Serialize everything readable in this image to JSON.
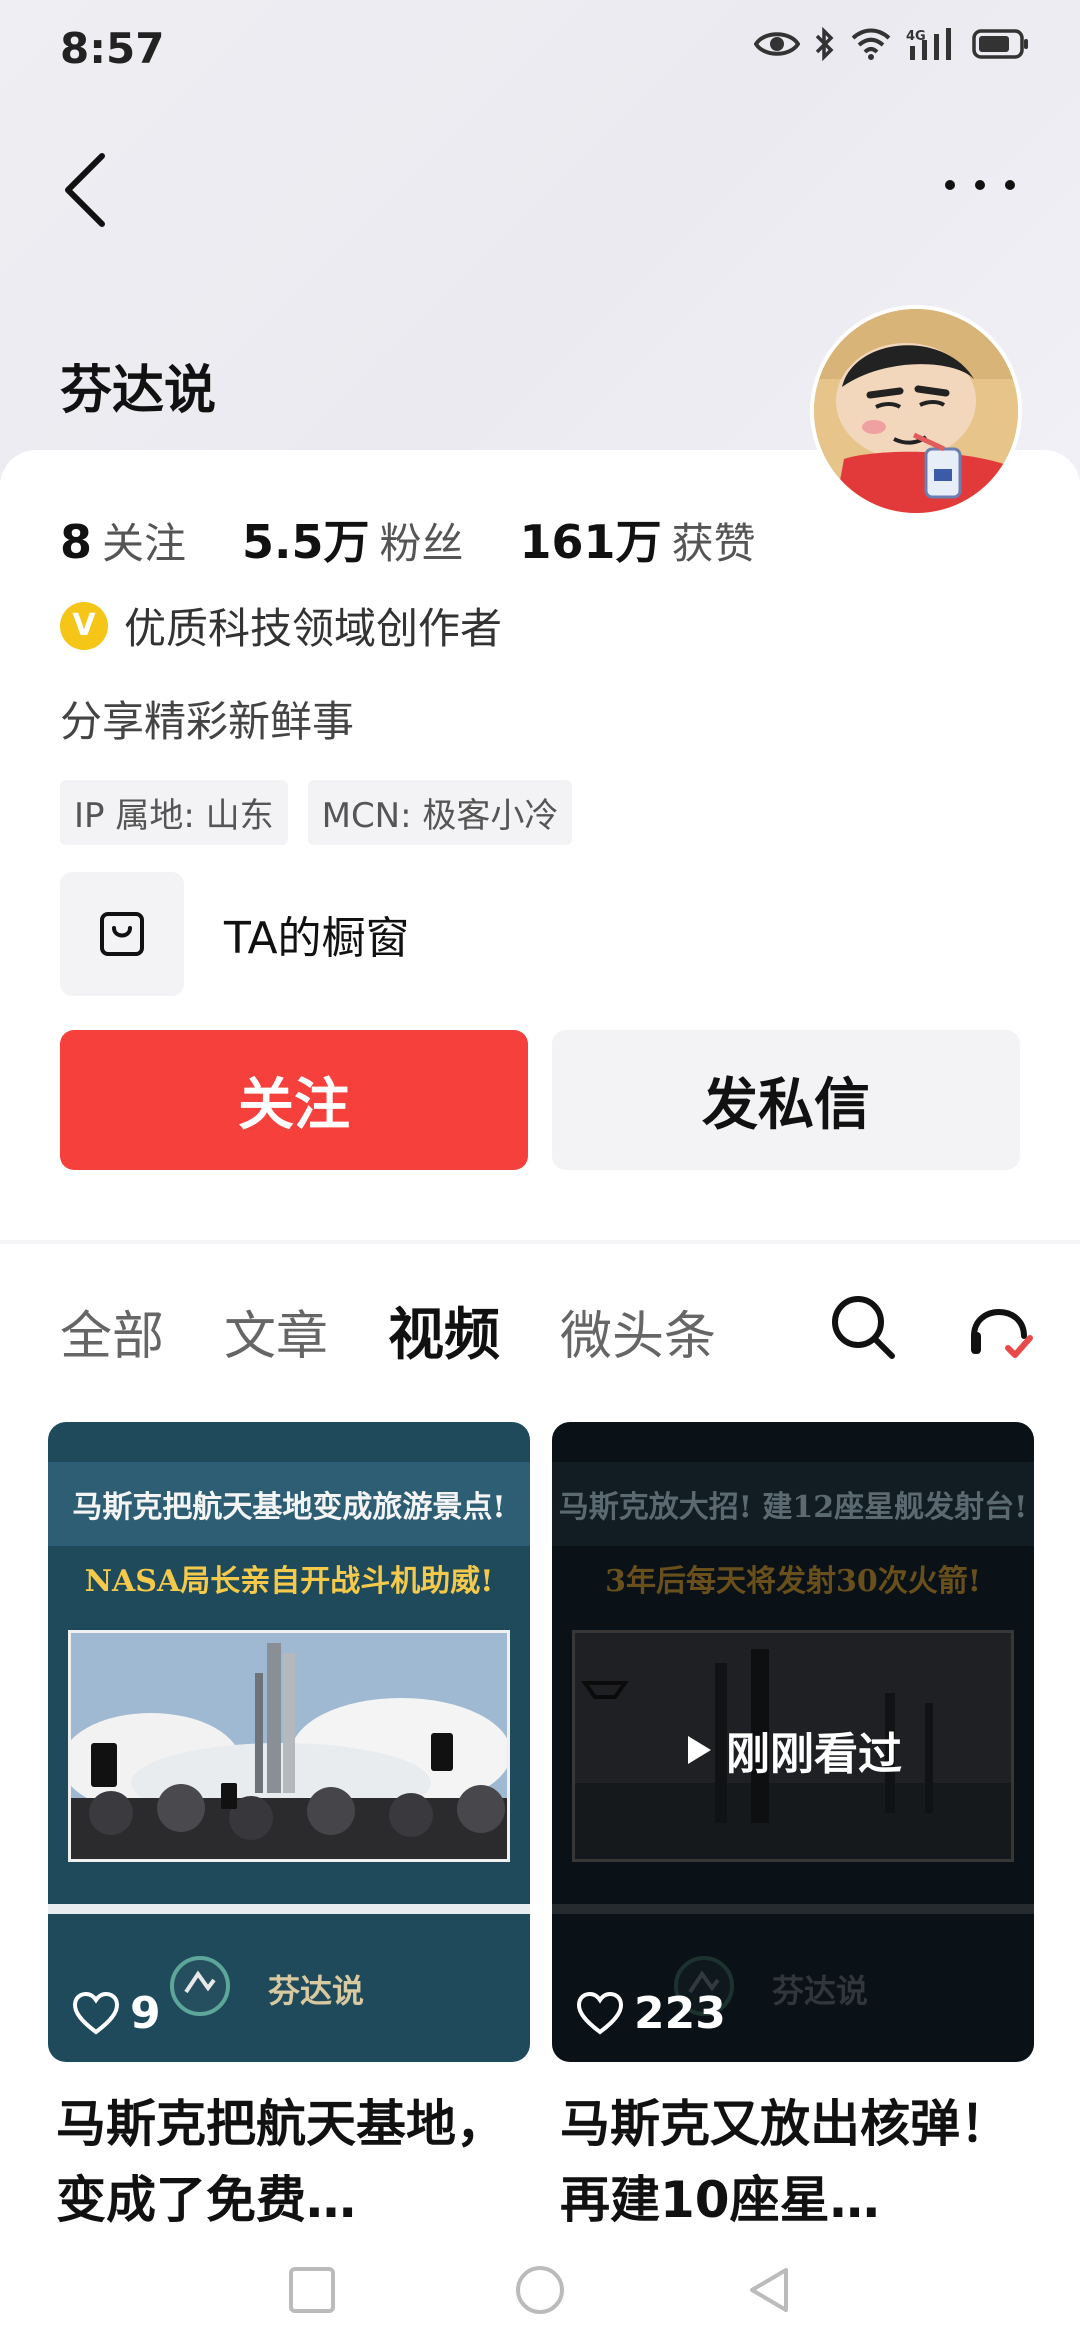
{
  "status_bar": {
    "time": "8:57"
  },
  "profile": {
    "name": "芬达说",
    "stats": [
      {
        "num": "8",
        "label": "关注"
      },
      {
        "num": "5.5万",
        "label": "粉丝"
      },
      {
        "num": "161万",
        "label": "获赞"
      }
    ],
    "verify_badge": "V",
    "verify_text": "优质科技领域创作者",
    "bio": "分享精彩新鲜事",
    "tags": [
      "IP 属地: 山东",
      "MCN: 极客小冷"
    ],
    "shop_label": "TA的橱窗",
    "follow_label": "关注",
    "message_label": "发私信"
  },
  "tabs": [
    {
      "label": "全部",
      "active": false
    },
    {
      "label": "文章",
      "active": false
    },
    {
      "label": "视频",
      "active": true
    },
    {
      "label": "微头条",
      "active": false
    }
  ],
  "videos": [
    {
      "thumb_line1": "马斯克把航天基地变成旅游景点!",
      "thumb_line2": "NASA局长亲自开战斗机助威!",
      "thumb_author": "芬达说",
      "likes": "9",
      "title": "马斯克把航天基地，变成了免费…",
      "watched": false
    },
    {
      "thumb_line1": "马斯克放大招! 建12座星舰发射台!",
      "thumb_line2": "3年后每天将发射30次火箭!",
      "thumb_author": "芬达说",
      "likes": "223",
      "title": "马斯克又放出核弹！再建10座星…",
      "watched": true,
      "watched_label": "刚刚看过"
    }
  ],
  "colors": {
    "follow": "#f5403c",
    "verify": "#f5c518",
    "headset_check": "#e84a4a"
  }
}
